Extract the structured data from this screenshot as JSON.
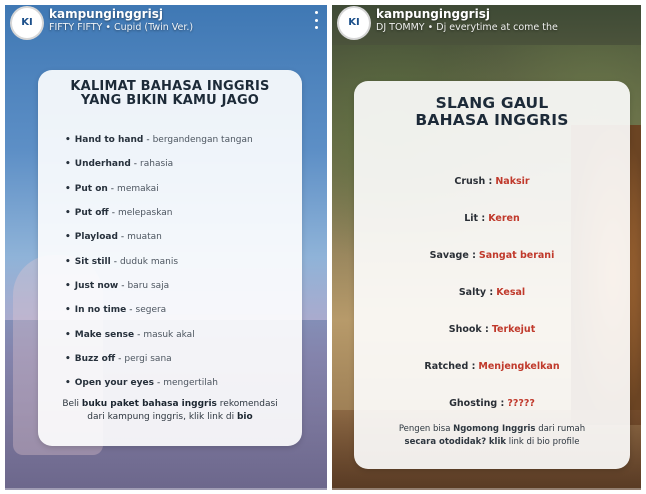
{
  "left_story": {
    "username": "kampunginggrisj",
    "track": "FIFTY FIFTY • Cupid (Twin Ver.)",
    "avatar_text": "KI",
    "card": {
      "title_line1": "KALIMAT BAHASA INGGRIS",
      "title_line2": "YANG BIKIN KAMU JAGO",
      "phrases": [
        {
          "term": "Hand to hand",
          "meaning": "bergandengan tangan"
        },
        {
          "term": "Underhand",
          "meaning": "rahasia"
        },
        {
          "term": "Put on",
          "meaning": "memakai"
        },
        {
          "term": "Put off",
          "meaning": "melepaskan"
        },
        {
          "term": "Playload",
          "meaning": "muatan"
        },
        {
          "term": "Sit still",
          "meaning": "duduk manis"
        },
        {
          "term": "Just now",
          "meaning": "baru saja"
        },
        {
          "term": "In no time",
          "meaning": "segera"
        },
        {
          "term": "Make sense",
          "meaning": "masuk akal"
        },
        {
          "term": "Buzz off",
          "meaning": "pergi sana"
        },
        {
          "term": "Open your eyes",
          "meaning": "mengertilah"
        }
      ],
      "bullet": "•",
      "separator": "-",
      "cta": {
        "t1": "Beli ",
        "b1": "buku paket bahasa inggris",
        "t2": " rekomendasi dari kampung inggris, klik link di ",
        "b2": "bio"
      }
    }
  },
  "right_story": {
    "username": "kampunginggrisj",
    "track": "DJ TOMMY • Dj everytime at come the",
    "avatar_text": "KI",
    "card": {
      "title_line1": "SLANG GAUL",
      "title_line2": "BAHASA INGGRIS",
      "slang": [
        {
          "term": "Crush :",
          "meaning": "Naksir"
        },
        {
          "term": "Lit :",
          "meaning": "Keren"
        },
        {
          "term": "Savage :",
          "meaning": "Sangat berani"
        },
        {
          "term": "Salty :",
          "meaning": "Kesal"
        },
        {
          "term": "Shook :",
          "meaning": "Terkejut"
        },
        {
          "term": "Ratched :",
          "meaning": "Menjengkelkan"
        },
        {
          "term": "Ghosting :",
          "meaning": "?????"
        }
      ],
      "cta": {
        "t1": "Pengen bisa ",
        "b1": "Ngomong Inggris",
        "t2": " dari rumah ",
        "b2": "secara otodidak?",
        "t3": " ",
        "b3": "klik",
        "t4": " link di bio profile"
      }
    }
  },
  "colors": {
    "accent_red": "#c0392b",
    "text_dark": "#1c2a38"
  }
}
